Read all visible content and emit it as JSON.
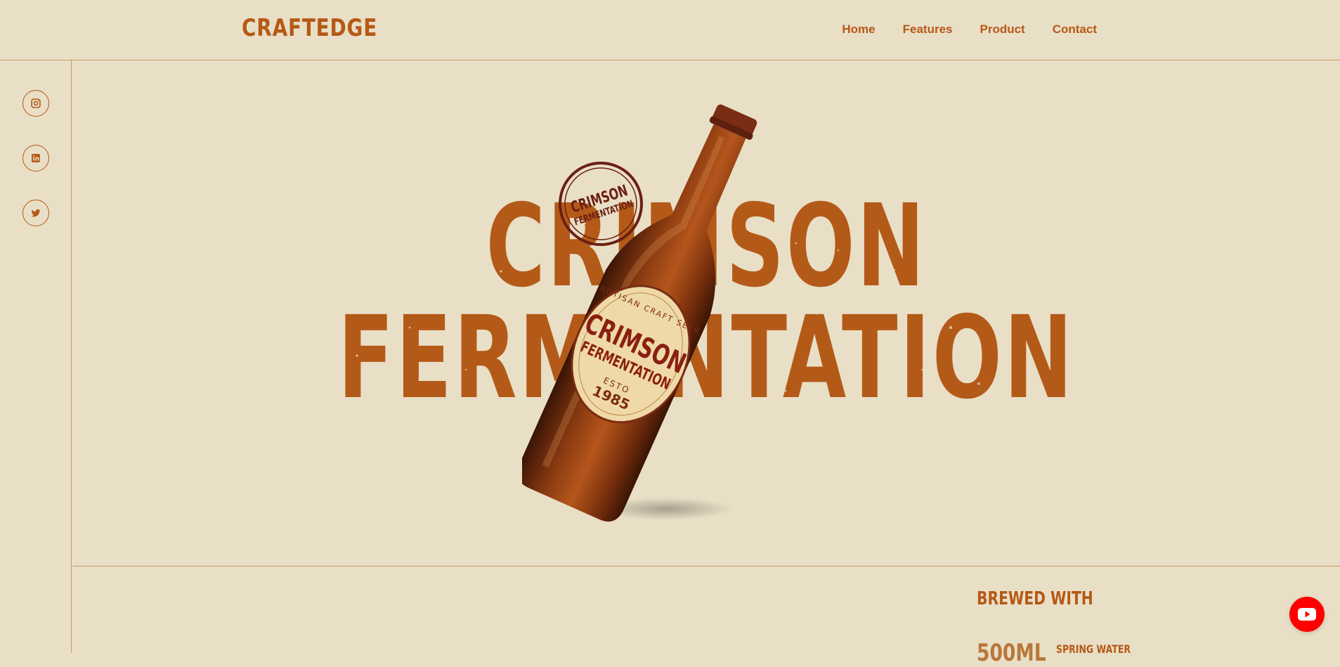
{
  "header": {
    "logo": "CRAFTEDGE",
    "nav": [
      {
        "label": "Home"
      },
      {
        "label": "Features"
      },
      {
        "label": "Product"
      },
      {
        "label": "Contact"
      }
    ]
  },
  "social": [
    {
      "icon": "instagram-icon"
    },
    {
      "icon": "linkedin-icon"
    },
    {
      "icon": "twitter-icon"
    }
  ],
  "hero": {
    "line1": "CRIMSON",
    "line2": "FERMENTATION",
    "stamp": {
      "line1": "CRIMSON",
      "line2": "FERMENTATION"
    },
    "bottle_label": {
      "arc_text": "ROTISAN CRAFT SEER",
      "name_line1": "CRIMSON",
      "name_line2": "FERMENTATION",
      "esto": "ESTO",
      "year": "1985"
    }
  },
  "lower": {
    "heading": "BREWED WITH",
    "volume": "500ML",
    "ingredient": "SPRING WATER"
  },
  "floating": {
    "icon": "youtube-icon"
  },
  "colors": {
    "background": "#e9dfc6",
    "accent": "#b55916",
    "stamp": "#6b1f14",
    "youtube": "#ff0000"
  }
}
